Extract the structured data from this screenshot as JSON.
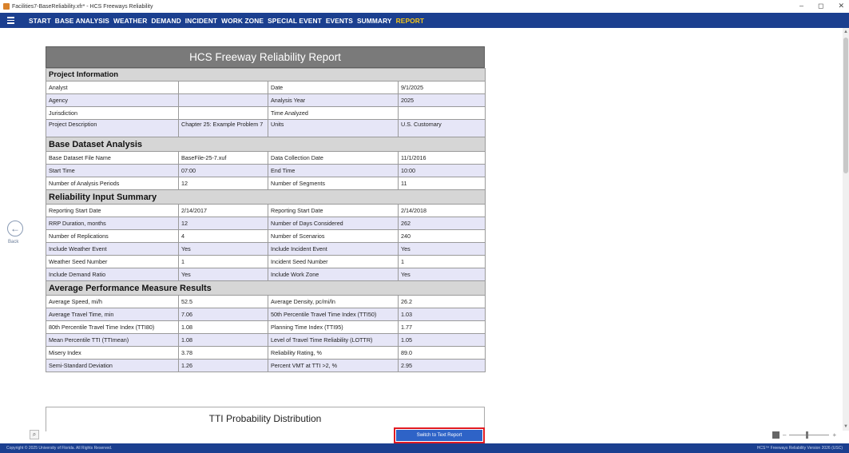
{
  "window": {
    "title": "Facilities7-BaseReliability.xfr* - HCS Freeways Reliability",
    "minimize": "–",
    "maximize": "◻",
    "close": "✕"
  },
  "menu": {
    "items": [
      "START",
      "BASE ANALYSIS",
      "WEATHER",
      "DEMAND",
      "INCIDENT",
      "WORK ZONE",
      "SPECIAL EVENT",
      "EVENTS",
      "SUMMARY",
      "REPORT"
    ],
    "active": "REPORT"
  },
  "nav": {
    "back_label": "Back"
  },
  "report": {
    "title": "HCS Freeway Reliability Report",
    "sections": {
      "project_information": {
        "heading": "Project Information",
        "rows": [
          [
            "Analyst",
            "",
            "Date",
            "9/1/2025"
          ],
          [
            "Agency",
            "",
            "Analysis Year",
            "2025"
          ],
          [
            "Jurisdiction",
            "",
            "Time Analyzed",
            ""
          ],
          [
            "Project Description",
            "Chapter 25: Example Problem 7",
            "Units",
            "U.S. Customary"
          ]
        ]
      },
      "base_dataset": {
        "heading": "Base Dataset Analysis",
        "rows": [
          [
            "Base Dataset File Name",
            "BaseFile-25-7.xuf",
            "Data Collection Date",
            "11/1/2016"
          ],
          [
            "Start Time",
            "07:00",
            "End Time",
            "10:00"
          ],
          [
            "Number of Analysis Periods",
            "12",
            "Number of Segments",
            "11"
          ]
        ]
      },
      "reliability_input": {
        "heading": "Reliability Input Summary",
        "rows": [
          [
            "Reporting Start Date",
            "2/14/2017",
            "Reporting Start Date",
            "2/14/2018"
          ],
          [
            "RRP Duration, months",
            "12",
            "Number of Days Considered",
            "262"
          ],
          [
            "Number of Replications",
            "4",
            "Number of Scenarios",
            "240"
          ],
          [
            "Include Weather Event",
            "Yes",
            "Include Incident Event",
            "Yes"
          ],
          [
            "Weather Seed Number",
            "1",
            "Incident Seed Number",
            "1"
          ],
          [
            "Include Demand Ratio",
            "Yes",
            "Include Work Zone",
            "Yes"
          ]
        ]
      },
      "performance_results": {
        "heading": "Average Performance Measure Results",
        "rows": [
          [
            "Average Speed, mi/h",
            "52.5",
            "Average Density, pc/mi/ln",
            "26.2"
          ],
          [
            "Average Travel Time, min",
            "7.06",
            "50th Percentile Travel Time Index (TTI50)",
            "1.03"
          ],
          [
            "80th Percentile Travel Time Index (TTI80)",
            "1.08",
            "Planning Time Index (TTI95)",
            "1.77"
          ],
          [
            "Mean Percentile TTI (TTImean)",
            "1.08",
            "Level of Travel Time Reliability (LOTTR)",
            "1.05"
          ],
          [
            "Misery Index",
            "3.78",
            "Reliability Rating, %",
            "89.0"
          ],
          [
            "Semi-Standard Deviation",
            "1.26",
            "Percent VMT at TTI >2, %",
            "2.95"
          ]
        ]
      }
    },
    "next_section_title": "TTI Probability Distribution"
  },
  "controls": {
    "switch_button": "Switch to Text Report",
    "zoom_minus": "–",
    "zoom_plus": "+",
    "zoom_level_fraction": 0.45
  },
  "status": {
    "copyright": "Copyright © 2025 University of Florida. All Rights Reserved.",
    "version": "HCS™ Freeways Reliability Version 2026 (USC)"
  },
  "colors": {
    "menubar": "#1b3f8f",
    "active_menu": "#f5c518",
    "title_band": "#7a7a7a",
    "row_shade": "#e6e6f7",
    "highlight_outline": "#e11b22"
  }
}
